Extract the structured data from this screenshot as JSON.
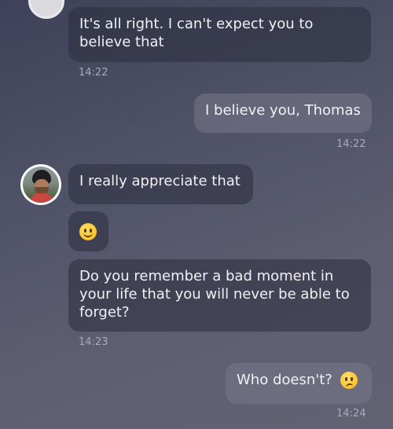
{
  "messages": [
    {
      "id": "m1",
      "direction": "incoming",
      "text": "It's all right. I can't expect you to believe that",
      "time": "14:22"
    },
    {
      "id": "m2",
      "direction": "outgoing",
      "text": "I believe you, Thomas",
      "time": "14:22"
    },
    {
      "id": "m3",
      "direction": "incoming",
      "text": "I really appreciate that"
    },
    {
      "id": "m4",
      "direction": "incoming",
      "emoji": "slightly-smiling-face"
    },
    {
      "id": "m5",
      "direction": "incoming",
      "text": "Do you remember a bad moment in your life that you will never be able to forget?",
      "time": "14:23"
    },
    {
      "id": "m6",
      "direction": "outgoing",
      "text": "Who doesn't?",
      "emoji": "confused-face",
      "time": "14:24"
    }
  ]
}
